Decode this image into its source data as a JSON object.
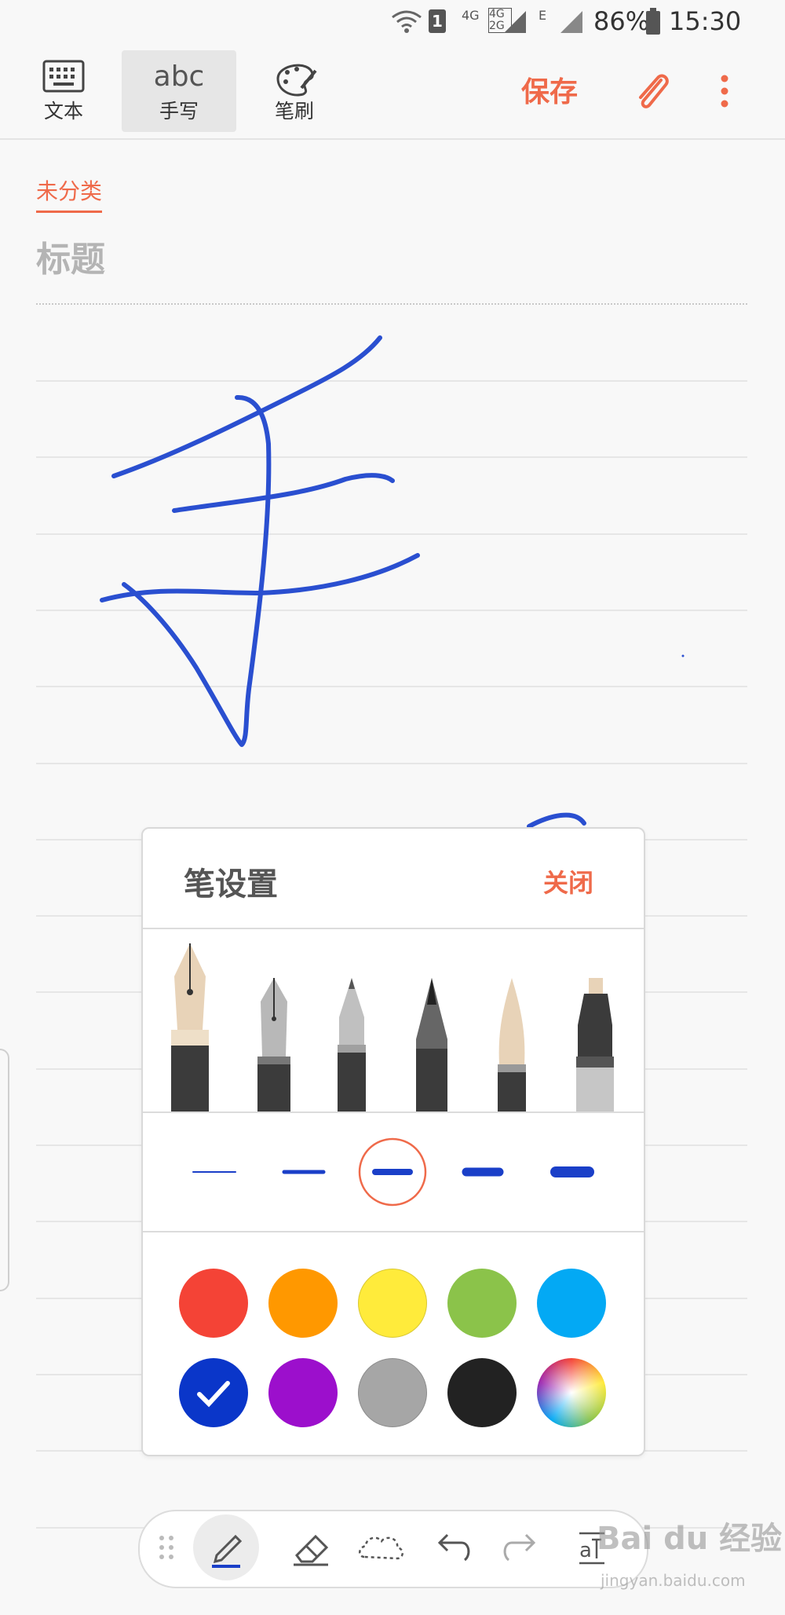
{
  "status_bar": {
    "sim_slot": "1",
    "network_4g": "4G",
    "network_4g2g": "4G 2G",
    "network_e": "E",
    "battery": "86%",
    "time": "15:30"
  },
  "toolbar": {
    "modes": [
      {
        "label": "文本",
        "icon": "keyboard-icon"
      },
      {
        "label": "手写",
        "icon": "abc-handwriting-icon",
        "icon_text": "abc"
      },
      {
        "label": "笔刷",
        "icon": "palette-icon"
      }
    ],
    "active_mode": "手写",
    "save_label": "保存",
    "attach_icon": "paperclip-icon",
    "more_icon": "more-vert-icon"
  },
  "note": {
    "category": "未分类",
    "title_placeholder": "标题"
  },
  "pen_settings": {
    "title": "笔设置",
    "close_label": "关闭",
    "pens": [
      "fountain-pen",
      "calligraphy-pen",
      "pencil",
      "brush-pen",
      "paint-brush",
      "marker"
    ],
    "selected_pen": "fountain-pen",
    "sizes_count": 5,
    "selected_size_index": 2,
    "stroke_color": "#1a3fc8",
    "colors_row1": [
      "#f44336",
      "#ff9800",
      "#ffeb3b",
      "#8bc34a",
      "#03a9f4"
    ],
    "colors_row2": [
      "#0a36c9",
      "#9c0fcc",
      "#a6a6a6",
      "#222222",
      "rainbow"
    ],
    "selected_color": "#0a36c9",
    "accent": "#ef6a4a"
  },
  "bottom_tools": [
    "drag-handle-icon",
    "pen-icon",
    "eraser-icon",
    "lasso-icon",
    "undo-icon",
    "redo-icon",
    "text-convert-icon"
  ],
  "watermark": {
    "main": "Bai du 经验",
    "sub": "jingyan.baidu.com"
  }
}
